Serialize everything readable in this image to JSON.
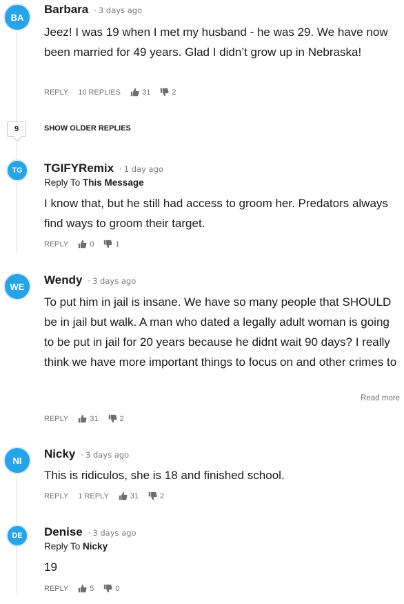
{
  "comments": [
    {
      "initials": "BA",
      "author": "Barbara",
      "time": "3 days ago",
      "body": "Jeez! I was 19 when I met my husband - he was 29. We have now been married for 49 years. Glad I didn’t grow up in Nebraska!",
      "reply_label": "REPLY",
      "replies_label": "10 REPLIES",
      "likes": "31",
      "dislikes": "2"
    },
    {
      "initials": "TG",
      "author": "TGIFYRemix",
      "time": "1 day ago",
      "reply_to_prefix": "Reply To",
      "reply_to_target": "This Message",
      "body": "I know that, but he still had access to groom her. Predators always find ways to groom their target.",
      "reply_label": "REPLY",
      "likes": "0",
      "dislikes": "1"
    },
    {
      "initials": "WE",
      "author": "Wendy",
      "time": "3 days ago",
      "body": "To put him in jail is insane. We have so many people that SHOULD be in jail but walk. A man who dated a legally adult woman is going to be put in jail for 20 years because he didnt wait 90 days? I really think we have more important things to focus on and other crimes to focus on than to put this man in j…",
      "read_more": "Read more",
      "reply_label": "REPLY",
      "likes": "31",
      "dislikes": "2"
    },
    {
      "initials": "NI",
      "author": "Nicky",
      "time": "3 days ago",
      "body": "This is ridiculos, she is 18 and finished school.",
      "reply_label": "REPLY",
      "replies_label": "1 REPLY",
      "likes": "31",
      "dislikes": "2"
    },
    {
      "initials": "DE",
      "author": "Denise",
      "time": "3 days ago",
      "reply_to_prefix": "Reply To",
      "reply_to_target": "Nicky",
      "body": "19",
      "reply_label": "REPLY",
      "likes": "5",
      "dislikes": "0"
    }
  ],
  "older_replies": {
    "count": "9",
    "label": "SHOW OLDER REPLIES"
  },
  "icons": {
    "like": "thumbs-up-icon",
    "dislike": "thumbs-down-icon"
  },
  "colors": {
    "avatar_bg": "#29a3e8",
    "muted_text": "#6e6e6e",
    "thread_line": "#dadada"
  }
}
